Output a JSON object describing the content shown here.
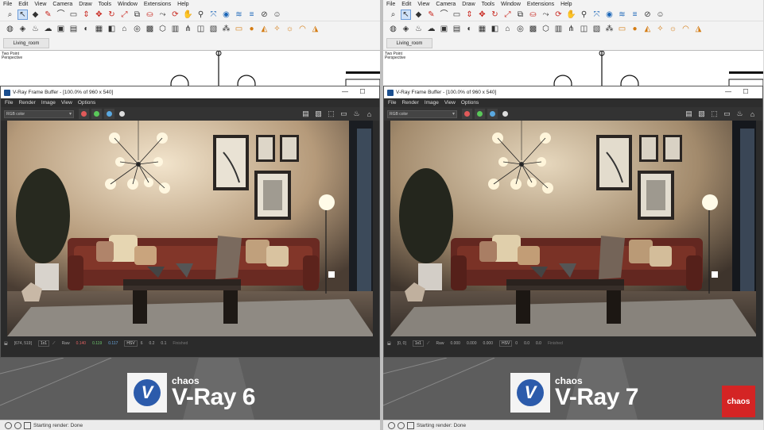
{
  "menu": [
    "File",
    "Edit",
    "View",
    "Camera",
    "Draw",
    "Tools",
    "Window",
    "Extensions",
    "Help"
  ],
  "scene_tab": "Living_room",
  "viewport": {
    "line1": "Two Point",
    "line2": "Perspective"
  },
  "vfb": {
    "title": "V-Ray Frame Buffer - [100.0% of 960 x 540]",
    "menu": [
      "File",
      "Render",
      "Image",
      "View",
      "Options"
    ],
    "channel": "RGB color",
    "win_min": "—",
    "win_max": "☐"
  },
  "status_left": {
    "coords": "[674, 519]",
    "ratio": "1x1",
    "raw": "Raw",
    "r": "0.140",
    "g": "0.119",
    "b": "0.117",
    "mode": "HSV",
    "h": "6",
    "s": "0.2",
    "v": "0.1",
    "state": "Finished"
  },
  "status_right": {
    "coords": "[0, 0]",
    "ratio": "1x1",
    "raw": "Raw",
    "r": "0.000",
    "g": "0.000",
    "b": "0.000",
    "mode": "HSV",
    "h": "0",
    "s": "0.0",
    "v": "0.0",
    "state": "Finished"
  },
  "brand_left": {
    "chaos": "chaos",
    "product": "V-Ray 6"
  },
  "brand_right": {
    "chaos": "chaos",
    "product": "V-Ray 7"
  },
  "app_status": "Starting render: Done",
  "chaos_badge": "chaos",
  "colors": {
    "red": "#e05a5a",
    "green": "#5ac85a",
    "blue": "#5aa8e0",
    "chaos_red": "#d42424",
    "vray_blue": "#2c5bab"
  }
}
